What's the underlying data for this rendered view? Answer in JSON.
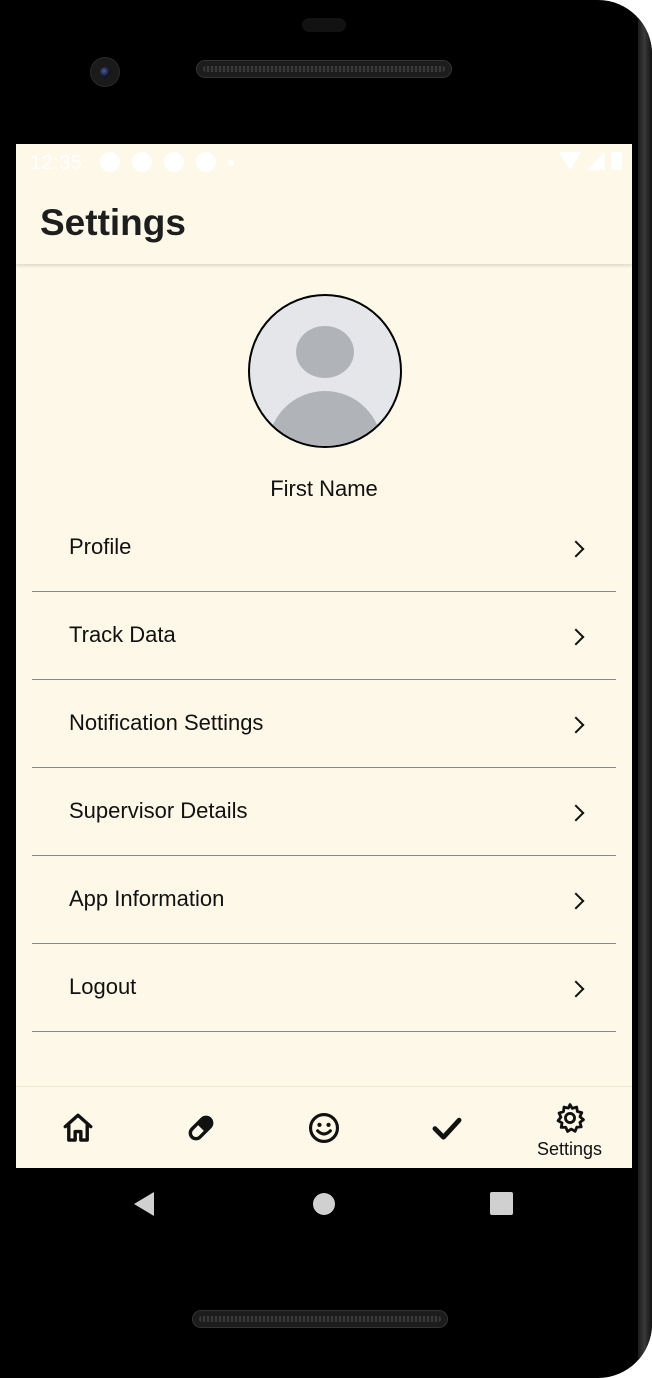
{
  "status_bar": {
    "time": "12:35"
  },
  "app_bar": {
    "title": "Settings"
  },
  "profile": {
    "name": "First Name"
  },
  "menu": {
    "items": [
      {
        "label": "Profile"
      },
      {
        "label": "Track Data"
      },
      {
        "label": "Notification Settings"
      },
      {
        "label": "Supervisor Details"
      },
      {
        "label": "App Information"
      },
      {
        "label": "Logout"
      }
    ]
  },
  "bottom_nav": {
    "items": [
      {
        "icon": "home-icon"
      },
      {
        "icon": "pill-icon"
      },
      {
        "icon": "smiley-icon"
      },
      {
        "icon": "check-icon"
      },
      {
        "icon": "gear-icon",
        "label": "Settings",
        "active": true
      }
    ]
  },
  "colors": {
    "background": "#fdf8e8",
    "text": "#111111",
    "divider": "#8a8a8a"
  }
}
